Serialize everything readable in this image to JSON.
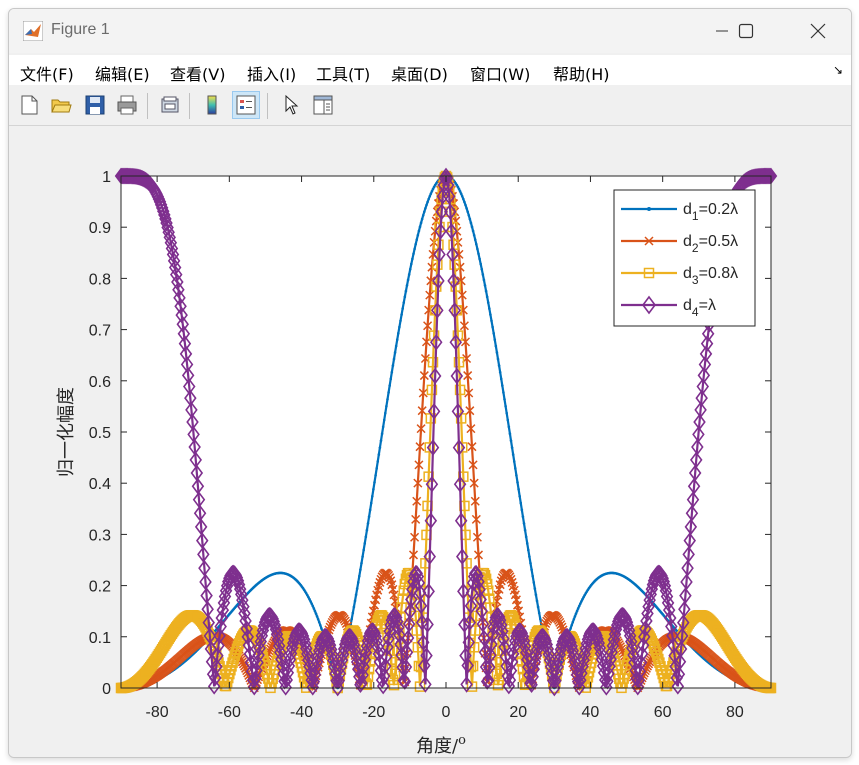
{
  "window": {
    "title": "Figure 1",
    "controls": [
      "minimize",
      "maximize",
      "close"
    ]
  },
  "menu": [
    "文件(F)",
    "编辑(E)",
    "查看(V)",
    "插入(I)",
    "工具(T)",
    "桌面(D)",
    "窗口(W)",
    "帮助(H)"
  ],
  "toolbar": {
    "tools": [
      "new-figure-icon",
      "open-file-icon",
      "save-icon",
      "print-icon",
      "link-plot-icon",
      "colorbar-icon",
      "legend-icon",
      "pointer-icon",
      "property-editor-icon"
    ]
  },
  "chart_data": {
    "type": "line",
    "title": "",
    "xlabel": "角度/",
    "xlabel_superscript": "o",
    "ylabel": "归一化幅度",
    "xlim": [
      -90,
      90
    ],
    "ylim": [
      0,
      1
    ],
    "xticks": [
      -80,
      -60,
      -40,
      -20,
      0,
      20,
      40,
      60,
      80
    ],
    "yticks": [
      0,
      0.1,
      0.2,
      0.3,
      0.4,
      0.5,
      0.6,
      0.7,
      0.8,
      0.9,
      1
    ],
    "grid": false,
    "legend_position": "top-right",
    "model": "normalized array factor |sin(N·π·d·sinθ)/(N·sin(π·d·sinθ))|, N = 10",
    "N": 10,
    "x_step": 0.3,
    "series": [
      {
        "legend_base": "d",
        "legend_sub": "1",
        "legend_tail": "=0.2λ",
        "spacing_wavelengths": 0.2,
        "color": "#0072BD",
        "marker": "point"
      },
      {
        "legend_base": "d",
        "legend_sub": "2",
        "legend_tail": "=0.5λ",
        "spacing_wavelengths": 0.5,
        "color": "#D95319",
        "marker": "x"
      },
      {
        "legend_base": "d",
        "legend_sub": "3",
        "legend_tail": "=0.8λ",
        "spacing_wavelengths": 0.8,
        "color": "#EDB120",
        "marker": "square"
      },
      {
        "legend_base": "d",
        "legend_sub": "4",
        "legend_tail": "=λ",
        "spacing_wavelengths": 1.0,
        "color": "#7E2F8E",
        "marker": "diamond"
      }
    ]
  }
}
